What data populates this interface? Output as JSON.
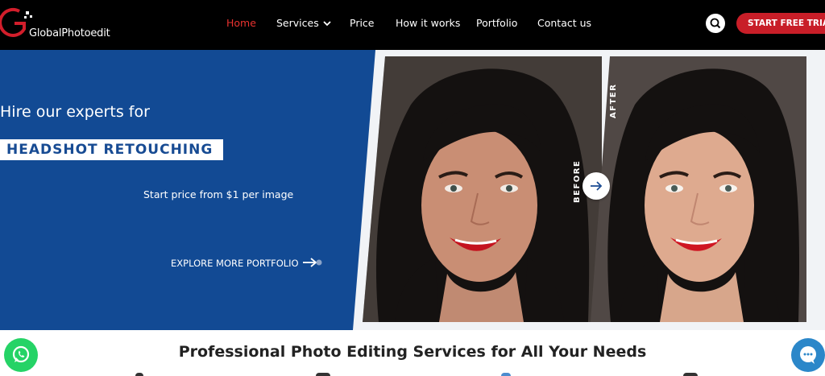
{
  "header": {
    "logo_text": "GlobalPhotoedit",
    "nav": [
      {
        "label": "Home",
        "active": true
      },
      {
        "label": "Services"
      },
      {
        "label": "Price"
      },
      {
        "label": "How it works"
      },
      {
        "label": "Portfolio"
      },
      {
        "label": "Contact us"
      }
    ],
    "search_icon": "search-icon",
    "cta_label": "START FREE TRIAL"
  },
  "hero": {
    "headline": "Hire our experts for",
    "service_tag": "HEADSHOT RETOUCHING",
    "price_text": "Start price from $1 per image",
    "explore_label": "EXPLORE MORE PORTFOLIO",
    "before_label": "BEFORE",
    "after_label": "AFTER",
    "compare_icon": "arrow-right-icon"
  },
  "section": {
    "title": "Professional Photo Editing Services for All Your Needs"
  },
  "floating": {
    "whatsapp_icon": "whatsapp-icon",
    "chat_icon": "chat-icon"
  },
  "colors": {
    "nav_bg": "#000000",
    "accent_red": "#c81e28",
    "active_link": "#e8322f",
    "hero_blue": "#124a94",
    "whatsapp_green": "#25d366",
    "chat_blue": "#2b87c9"
  }
}
